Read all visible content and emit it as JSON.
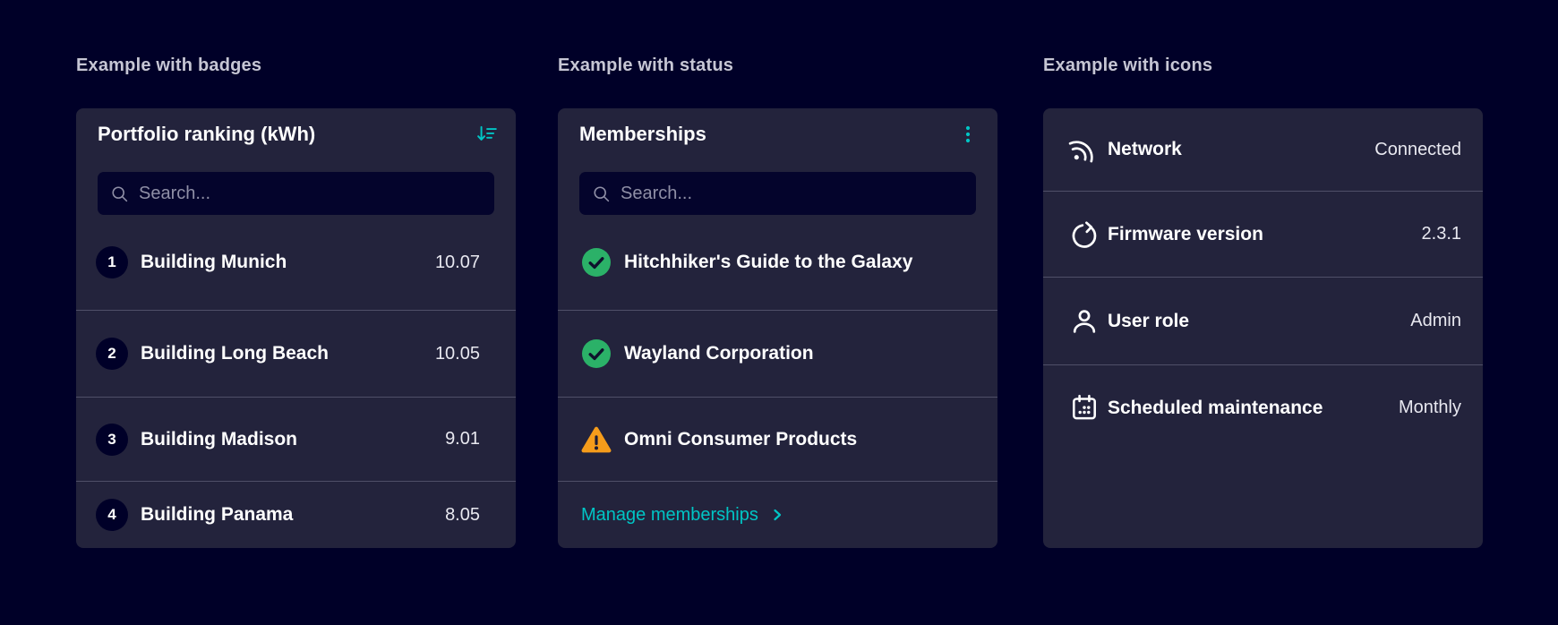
{
  "colors": {
    "background": "#000028",
    "card": "#23233C",
    "accent": "#00C5C5",
    "success": "#2BB168",
    "warning": "#F59C1B"
  },
  "sections": [
    {
      "heading": "Example with badges",
      "card": {
        "title": "Portfolio ranking (kWh)",
        "header_icon": "sort-descending-icon",
        "search": {
          "placeholder": "Search...",
          "value": ""
        },
        "items": [
          {
            "badge": "1",
            "label": "Building Munich",
            "value": "10.07"
          },
          {
            "badge": "2",
            "label": "Building Long Beach",
            "value": "10.05"
          },
          {
            "badge": "3",
            "label": "Building Madison",
            "value": "9.01"
          },
          {
            "badge": "4",
            "label": "Building Panama",
            "value": "8.05"
          }
        ]
      }
    },
    {
      "heading": "Example with status",
      "card": {
        "title": "Memberships",
        "header_icon": "kebab-menu-icon",
        "search": {
          "placeholder": "Search...",
          "value": ""
        },
        "items": [
          {
            "status": "success",
            "icon": "check-circle-icon",
            "label": "Hitchhiker's Guide to the Galaxy"
          },
          {
            "status": "success",
            "icon": "check-circle-icon",
            "label": "Wayland Corporation"
          },
          {
            "status": "warning",
            "icon": "warning-triangle-icon",
            "label": "Omni Consumer Products"
          }
        ],
        "footer_link": {
          "label": "Manage memberships",
          "icon": "chevron-right-icon"
        }
      }
    },
    {
      "heading": "Example with icons",
      "card": {
        "items": [
          {
            "icon": "network-icon",
            "label": "Network",
            "value": "Connected"
          },
          {
            "icon": "firmware-icon",
            "label": "Firmware version",
            "value": "2.3.1"
          },
          {
            "icon": "user-icon",
            "label": "User role",
            "value": "Admin"
          },
          {
            "icon": "calendar-icon",
            "label": "Scheduled maintenance",
            "value": "Monthly"
          }
        ]
      }
    }
  ]
}
